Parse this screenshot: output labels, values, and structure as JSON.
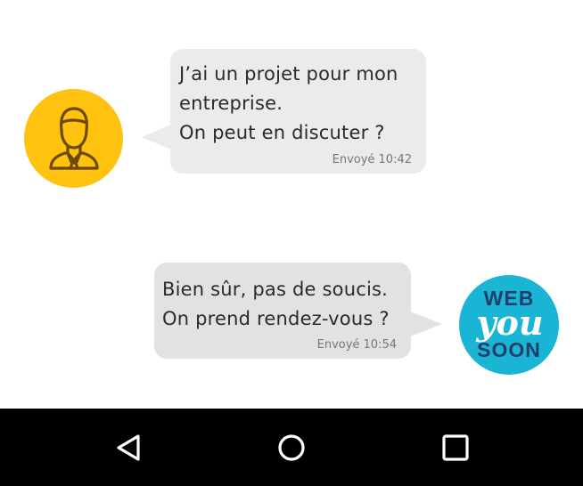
{
  "conversation": {
    "messages": [
      {
        "direction": "received",
        "text": "J’ai un projet pour mon\nentreprise.\nOn peut en discuter ?",
        "timestamp": "Envoyé 10:42",
        "avatar_icon": "businessman-icon"
      },
      {
        "direction": "sent",
        "text": "Bien sûr, pas de soucis.\nOn prend rendez-vous ?",
        "timestamp": "Envoyé 10:54",
        "avatar_icon": "webyousoon-logo"
      }
    ]
  },
  "brand_logo": {
    "line1": "WEB",
    "line2": "you",
    "line3": "SOON"
  },
  "navbar": {
    "buttons": [
      {
        "name": "back",
        "icon": "back-triangle-icon"
      },
      {
        "name": "home",
        "icon": "home-circle-icon"
      },
      {
        "name": "recents",
        "icon": "recents-square-icon"
      }
    ]
  },
  "colors": {
    "user_avatar_bg": "#FFC20E",
    "user_avatar_line": "#6B4A00",
    "brand_avatar_bg": "#1AB5D5",
    "brand_text_dark": "#1F3F6B",
    "bubble_bg": "#EBEBEB",
    "navbar_bg": "#000000"
  }
}
